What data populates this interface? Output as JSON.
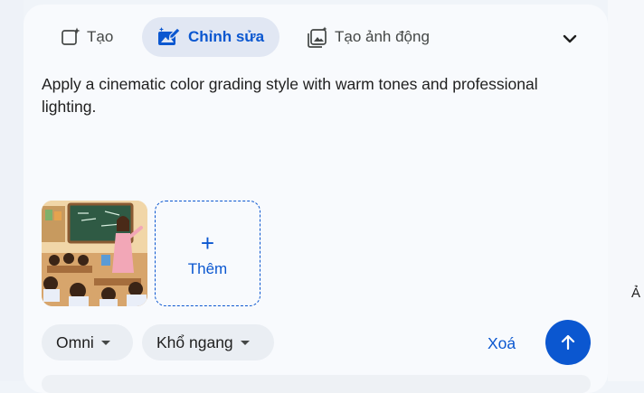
{
  "tabs": {
    "create_label": "Tạo",
    "edit_label": "Chỉnh sửa",
    "animate_label": "Tạo ảnh động"
  },
  "prompt": {
    "text": "Apply a cinematic color grading style with warm tones and professional lighting."
  },
  "attachments": {
    "add_label": "Thêm",
    "add_symbol": "+"
  },
  "controls": {
    "model_label": "Omni",
    "aspect_label": "Khổ ngang",
    "clear_label": "Xoá"
  },
  "edge_text": "Ả",
  "colors": {
    "accent": "#0b57d0",
    "active_tab_bg": "#e1e7f3",
    "card_bg": "#f8fafd",
    "chip_bg": "#eaeef3"
  },
  "icons": {
    "create": "image-sparkle-icon",
    "edit": "edit-image-icon",
    "animate": "animate-images-icon",
    "expand": "chevron-down-icon",
    "send": "arrow-up-icon"
  }
}
